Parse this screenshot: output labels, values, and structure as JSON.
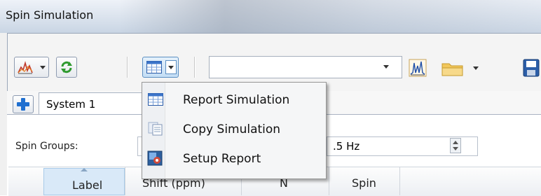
{
  "window": {
    "title": "Spin Simulation"
  },
  "toolbar": {
    "combo_value": "",
    "icons": [
      "spectrum-tool-icon",
      "refresh-icon",
      "grid-view-icon",
      "spectrum-peaks-icon",
      "folder-icon",
      "save-icon"
    ]
  },
  "tabs": [
    {
      "label": "System 1"
    }
  ],
  "dropdown_menu": {
    "items": [
      {
        "label": "Report Simulation",
        "icon": "table-icon"
      },
      {
        "label": "Copy Simulation",
        "icon": "copy-icon"
      },
      {
        "label": "Setup Report",
        "icon": "setup-report-icon"
      }
    ]
  },
  "spin_groups": {
    "label": "Spin Groups:",
    "value_fragment": ")",
    "line_width_value": ".5 Hz"
  },
  "grid": {
    "columns": [
      "Label",
      "Shift (ppm)",
      "N",
      "Spin"
    ]
  },
  "colors": {
    "accent_blue": "#1f6fd0",
    "menu_bg": "#f5f6f7",
    "selected_header": "#d9e9f8"
  }
}
